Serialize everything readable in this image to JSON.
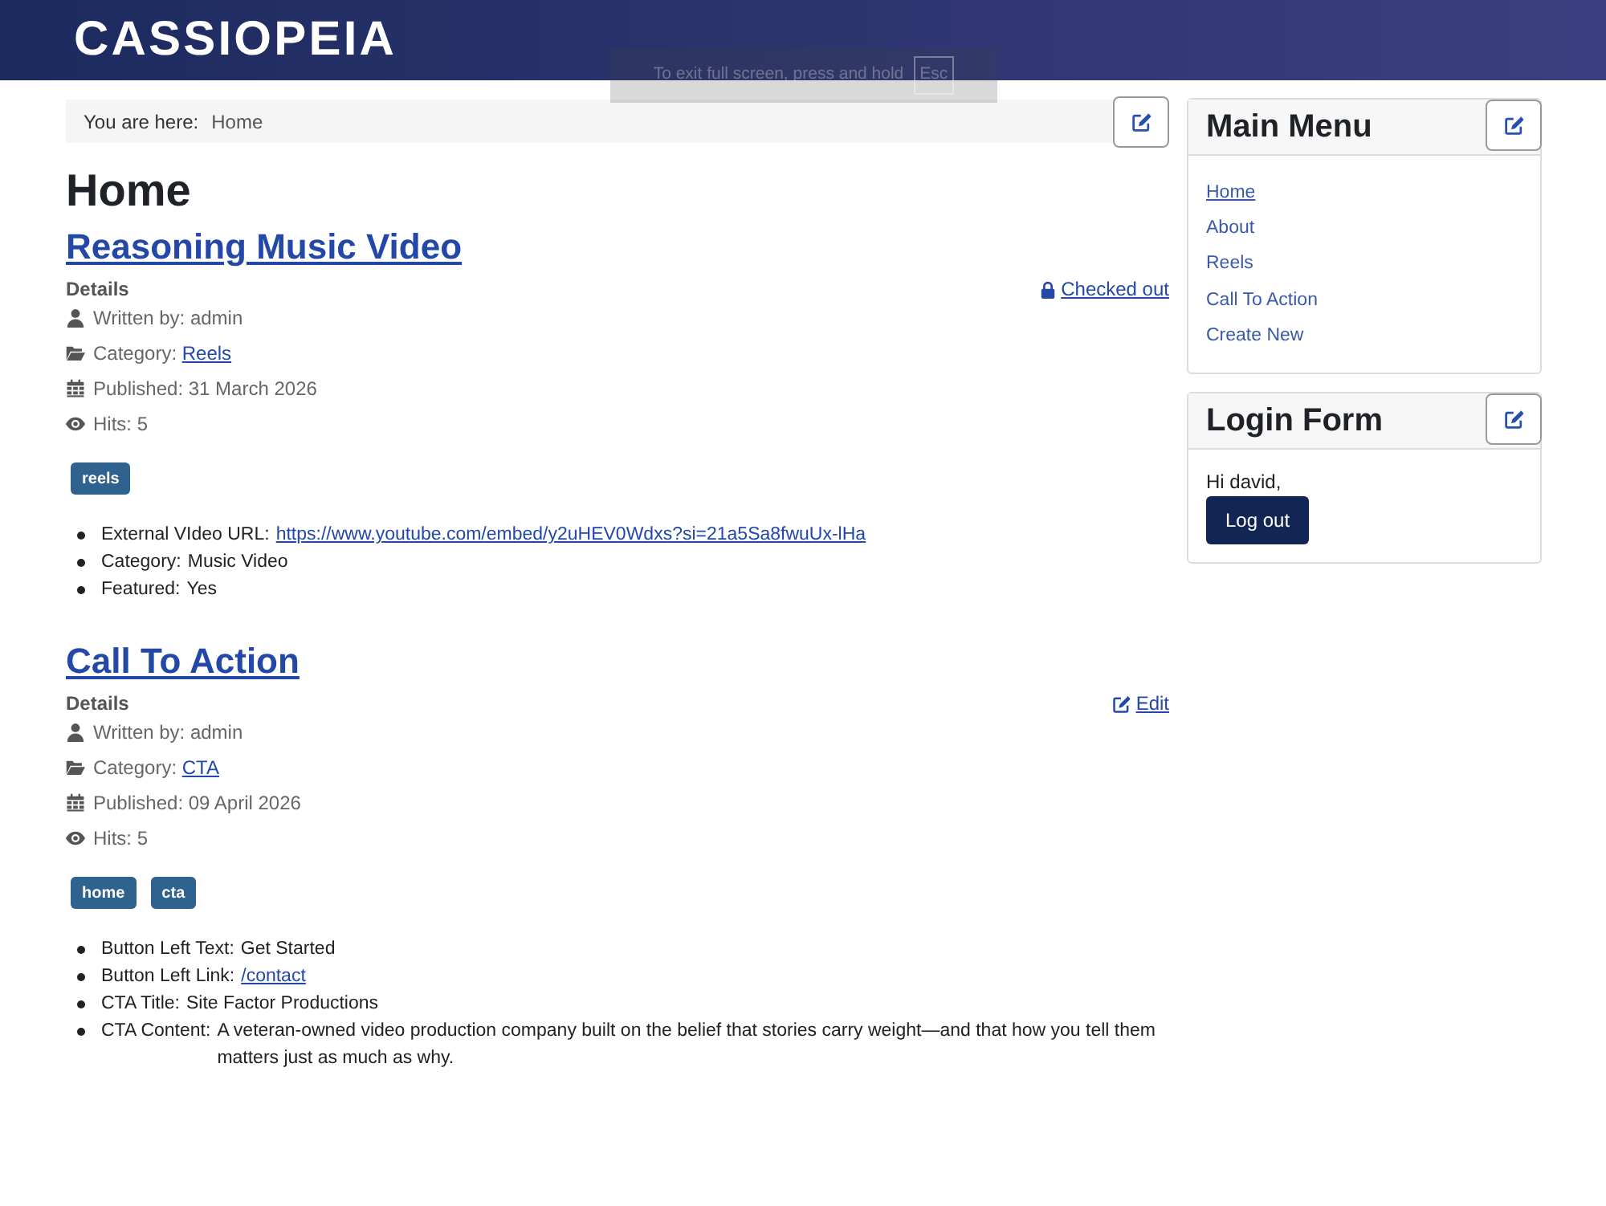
{
  "header": {
    "logo": "CASSIOPEIA"
  },
  "fullscreen_notice": {
    "text": "To exit full screen, press and hold",
    "key": "Esc"
  },
  "breadcrumb": {
    "label": "You are here:",
    "items": [
      "Home"
    ]
  },
  "page_title": "Home",
  "articles": [
    {
      "title": "Reasoning Music Video",
      "details_label": "Details",
      "action": {
        "kind": "checked_out",
        "label": "Checked out"
      },
      "meta": [
        {
          "kind": "author",
          "label": "Written by: admin"
        },
        {
          "kind": "category",
          "label": "Category:",
          "link": "Reels"
        },
        {
          "kind": "published",
          "label": "Published: 31 March 2026"
        },
        {
          "kind": "hits",
          "label": "Hits: 5"
        }
      ],
      "tags": [
        "reels"
      ],
      "fields": [
        {
          "label": "External VIdeo URL:",
          "link": "https://www.youtube.com/embed/y2uHEV0Wdxs?si=21a5Sa8fwuUx-lHa"
        },
        {
          "label": "Category:",
          "value": "Music Video"
        },
        {
          "label": "Featured:",
          "value": "Yes"
        }
      ]
    },
    {
      "title": "Call To Action",
      "details_label": "Details",
      "action": {
        "kind": "edit",
        "label": "Edit"
      },
      "meta": [
        {
          "kind": "author",
          "label": "Written by: admin"
        },
        {
          "kind": "category",
          "label": "Category:",
          "link": "CTA"
        },
        {
          "kind": "published",
          "label": "Published: 09 April 2026"
        },
        {
          "kind": "hits",
          "label": "Hits: 5"
        }
      ],
      "tags": [
        "home",
        "cta"
      ],
      "fields": [
        {
          "label": "Button Left Text:",
          "value": "Get Started"
        },
        {
          "label": "Button Left Link:",
          "link": "/contact"
        },
        {
          "label": "CTA Title:",
          "value": "Site Factor Productions"
        },
        {
          "label": "CTA Content:",
          "value": "A veteran-owned video production company built on the belief that stories carry weight—and that how you tell them matters just as much as why."
        }
      ]
    }
  ],
  "sidebar": {
    "modules": [
      {
        "kind": "menu",
        "title": "Main Menu",
        "items": [
          {
            "label": "Home",
            "selected": true
          },
          {
            "label": "About",
            "selected": false
          },
          {
            "label": "Reels",
            "selected": false
          },
          {
            "label": "Call To Action",
            "selected": false
          },
          {
            "label": "Create New",
            "selected": false
          }
        ]
      },
      {
        "kind": "login",
        "title": "Login Form",
        "greeting": "Hi david,",
        "button": "Log out"
      }
    ]
  }
}
